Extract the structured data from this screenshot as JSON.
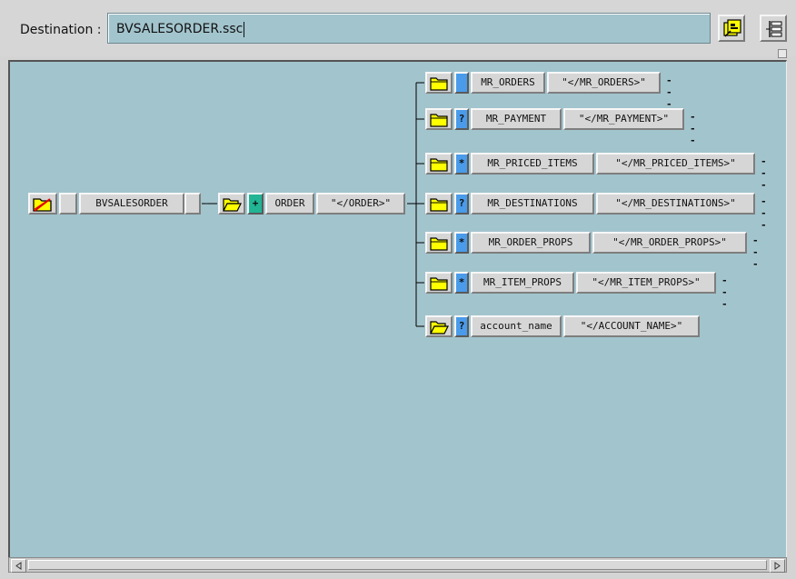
{
  "header": {
    "destination_label": "Destination :",
    "destination_value": "BVSALESORDER.ssc",
    "buttons": [
      {
        "name": "generate-icon",
        "label": ""
      },
      {
        "name": "tree-layout-icon",
        "label": ""
      }
    ]
  },
  "tree": {
    "root": {
      "name": "BVSALESORDER",
      "icon": "folder-no-icon",
      "modifier": ""
    },
    "order": {
      "name": "ORDER",
      "closing": "\"</ORDER>\"",
      "modifier": "+",
      "icon": "folder-open-icon"
    },
    "children": [
      {
        "name": "MR_ORDERS",
        "closing": "\"</MR_ORDERS>\"",
        "modifier": "",
        "trail": "---"
      },
      {
        "name": "MR_PAYMENT",
        "closing": "\"</MR_PAYMENT>\"",
        "modifier": "?",
        "trail": "---"
      },
      {
        "name": "MR_PRICED_ITEMS",
        "closing": "\"</MR_PRICED_ITEMS>\"",
        "modifier": "*",
        "trail": "---"
      },
      {
        "name": "MR_DESTINATIONS",
        "closing": "\"</MR_DESTINATIONS>\"",
        "modifier": "?",
        "trail": "---"
      },
      {
        "name": "MR_ORDER_PROPS",
        "closing": "\"</MR_ORDER_PROPS>\"",
        "modifier": "*",
        "trail": "---"
      },
      {
        "name": "MR_ITEM_PROPS",
        "closing": "\"</MR_ITEM_PROPS>\"",
        "modifier": "*",
        "trail": "---"
      },
      {
        "name": "account_name",
        "closing": "\"</ACCOUNT_NAME>\"",
        "modifier": "?",
        "trail": ""
      }
    ],
    "connector": "-"
  },
  "colors": {
    "canvas": "#a2c4cd",
    "modifier_blue": "#4a9bea",
    "modifier_green": "#21b595",
    "folder_yellow": "#ffff00"
  }
}
